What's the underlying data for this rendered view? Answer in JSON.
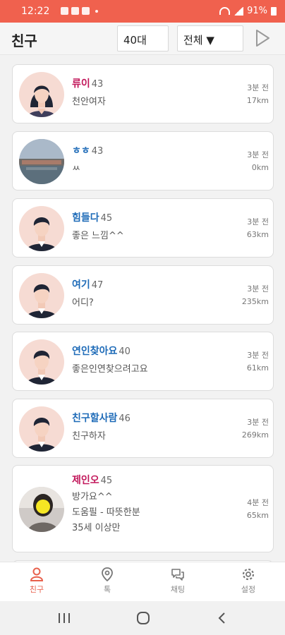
{
  "status_bar": {
    "time": "12:22",
    "battery": "91%"
  },
  "header": {
    "title": "친구",
    "age_filter": "40대",
    "gender_filter": "전체 ▼"
  },
  "friends": [
    {
      "name": "류이",
      "age": "43",
      "message": "천안여자",
      "time": "3분 전",
      "distance": "17km",
      "gender": "female",
      "avatar": "female-default"
    },
    {
      "name": "ㅎㅎ",
      "age": "43",
      "message": "ㅆ",
      "time": "3분 전",
      "distance": "0km",
      "gender": "male",
      "avatar": "landscape-photo"
    },
    {
      "name": "힘들다",
      "age": "45",
      "message": "좋은 느낌^^",
      "time": "3분 전",
      "distance": "63km",
      "gender": "male",
      "avatar": "male-default"
    },
    {
      "name": "여기",
      "age": "47",
      "message": "어디?",
      "time": "3분 전",
      "distance": "235km",
      "gender": "male",
      "avatar": "male-default"
    },
    {
      "name": "연인찾아요",
      "age": "40",
      "message": "좋은인연찾으려고요",
      "time": "3분 전",
      "distance": "61km",
      "gender": "male",
      "avatar": "male-default"
    },
    {
      "name": "친구할사람",
      "age": "46",
      "message": "친구하자",
      "time": "3분 전",
      "distance": "269km",
      "gender": "male",
      "avatar": "male-default"
    },
    {
      "name": "제인오",
      "age": "45",
      "message": "방가요^^",
      "message2": "도움필 - 따뜻한분",
      "message3": "35세 이상만",
      "time": "4분 전",
      "distance": "65km",
      "gender": "female",
      "avatar": "person-photo"
    }
  ],
  "bottom_nav": [
    {
      "label": "친구",
      "icon": "person-icon",
      "active": true
    },
    {
      "label": "톡",
      "icon": "location-pin-icon",
      "active": false
    },
    {
      "label": "채팅",
      "icon": "chat-bubbles-icon",
      "active": false
    },
    {
      "label": "설정",
      "icon": "gear-icon",
      "active": false
    }
  ],
  "colors": {
    "accent": "#f0614e",
    "female_name": "#c2185b",
    "male_name": "#1e6bb8"
  }
}
